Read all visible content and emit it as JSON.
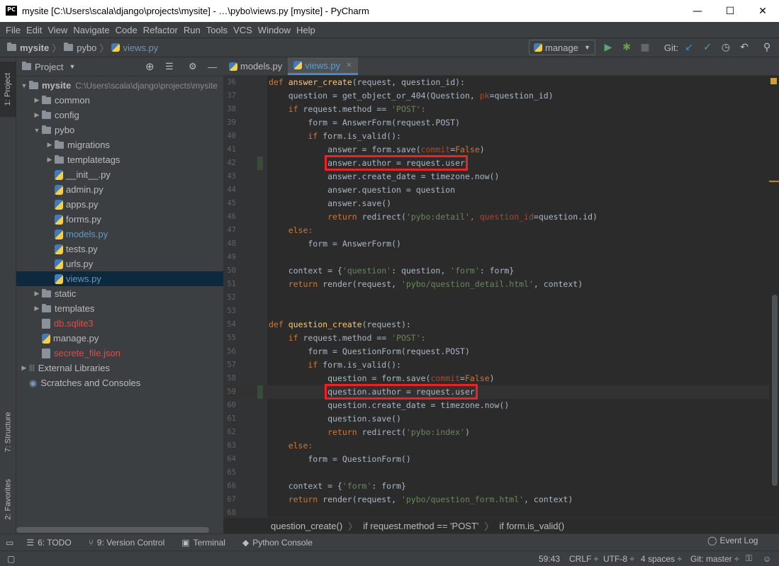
{
  "window": {
    "title": "mysite [C:\\Users\\scala\\django\\projects\\mysite] - …\\pybo\\views.py [mysite] - PyCharm",
    "logo": "PC"
  },
  "menu": [
    "File",
    "Edit",
    "View",
    "Navigate",
    "Code",
    "Refactor",
    "Run",
    "Tools",
    "VCS",
    "Window",
    "Help"
  ],
  "breadcrumbs": [
    "mysite",
    "pybo",
    "views.py"
  ],
  "run_config": "manage",
  "git_label": "Git:",
  "left_tabs": {
    "project": "1: Project",
    "structure": "7: Structure",
    "favorites": "2: Favorites"
  },
  "project_panel": {
    "title": "Project"
  },
  "tree": [
    {
      "label": "mysite",
      "path": "C:\\Users\\scala\\django\\projects\\mysite",
      "type": "folder",
      "depth": 0,
      "arrow": "▼"
    },
    {
      "label": "common",
      "type": "folder",
      "depth": 1,
      "arrow": "▶"
    },
    {
      "label": "config",
      "type": "folder",
      "depth": 1,
      "arrow": "▶"
    },
    {
      "label": "pybo",
      "type": "folder",
      "depth": 1,
      "arrow": "▼"
    },
    {
      "label": "migrations",
      "type": "folder",
      "depth": 2,
      "arrow": "▶"
    },
    {
      "label": "templatetags",
      "type": "folder",
      "depth": 2,
      "arrow": "▶"
    },
    {
      "label": "__init__.py",
      "type": "py",
      "depth": 2
    },
    {
      "label": "admin.py",
      "type": "py",
      "depth": 2
    },
    {
      "label": "apps.py",
      "type": "py",
      "depth": 2
    },
    {
      "label": "forms.py",
      "type": "py",
      "depth": 2
    },
    {
      "label": "models.py",
      "type": "py",
      "depth": 2,
      "color": "#6897bb"
    },
    {
      "label": "tests.py",
      "type": "py",
      "depth": 2
    },
    {
      "label": "urls.py",
      "type": "py",
      "depth": 2
    },
    {
      "label": "views.py",
      "type": "py",
      "depth": 2,
      "color": "#6897bb",
      "selected": true
    },
    {
      "label": "static",
      "type": "folder",
      "depth": 1,
      "arrow": "▶"
    },
    {
      "label": "templates",
      "type": "folder",
      "depth": 1,
      "arrow": "▶"
    },
    {
      "label": "db.sqlite3",
      "type": "file",
      "depth": 1,
      "color": "#d25252"
    },
    {
      "label": "manage.py",
      "type": "py",
      "depth": 1
    },
    {
      "label": "secrete_file.json",
      "type": "file",
      "depth": 1,
      "color": "#d25252"
    },
    {
      "label": "External Libraries",
      "type": "lib",
      "depth": 0,
      "arrow": "▶"
    },
    {
      "label": "Scratches and Consoles",
      "type": "scratch",
      "depth": 0
    }
  ],
  "tabs": [
    {
      "label": "models.py",
      "active": false
    },
    {
      "label": "views.py",
      "active": true
    }
  ],
  "code": [
    {
      "n": "36",
      "s": [
        [
          "kw",
          "def "
        ],
        [
          "fn",
          "answer_create"
        ],
        [
          "",
          "(request, question_id):"
        ]
      ]
    },
    {
      "n": "37",
      "s": [
        [
          "",
          "    question = get_object_or_404(Question, "
        ],
        [
          "param",
          "pk"
        ],
        [
          "",
          "=question_id)"
        ]
      ]
    },
    {
      "n": "38",
      "s": [
        [
          "kw",
          "    if "
        ],
        [
          "",
          "request.method == "
        ],
        [
          "str",
          "'POST'"
        ],
        [
          "kw",
          ":"
        ]
      ]
    },
    {
      "n": "39",
      "s": [
        [
          "",
          "        form = AnswerForm(request.POST)"
        ]
      ]
    },
    {
      "n": "40",
      "s": [
        [
          "kw",
          "        if "
        ],
        [
          "",
          "form.is_valid():"
        ]
      ]
    },
    {
      "n": "41",
      "s": [
        [
          "",
          "            answer = form.save("
        ],
        [
          "param",
          "commit"
        ],
        [
          "",
          "="
        ],
        [
          "kw",
          "False"
        ],
        [
          "",
          ")"
        ]
      ]
    },
    {
      "n": "42",
      "s": [
        [
          "",
          "            "
        ],
        [
          "hl",
          "answer.author = request.user"
        ]
      ]
    },
    {
      "n": "43",
      "s": [
        [
          "",
          "            answer.create_date = timezone.now()"
        ]
      ]
    },
    {
      "n": "44",
      "s": [
        [
          "",
          "            answer.question = question"
        ]
      ]
    },
    {
      "n": "45",
      "s": [
        [
          "",
          "            answer.save()"
        ]
      ]
    },
    {
      "n": "46",
      "s": [
        [
          "kw",
          "            return "
        ],
        [
          "",
          "redirect("
        ],
        [
          "str",
          "'pybo:detail'"
        ],
        [
          "kw",
          ", "
        ],
        [
          "param",
          "question_id"
        ],
        [
          "",
          "=question.id)"
        ]
      ]
    },
    {
      "n": "47",
      "s": [
        [
          "kw",
          "    else:"
        ]
      ]
    },
    {
      "n": "48",
      "s": [
        [
          "",
          "        form = AnswerForm()"
        ]
      ]
    },
    {
      "n": "49",
      "s": [
        [
          "",
          ""
        ]
      ]
    },
    {
      "n": "50",
      "s": [
        [
          "",
          "    context = {"
        ],
        [
          "str",
          "'question'"
        ],
        [
          "",
          ": question, "
        ],
        [
          "str",
          "'form'"
        ],
        [
          "",
          ": form}"
        ]
      ]
    },
    {
      "n": "51",
      "s": [
        [
          "kw",
          "    return "
        ],
        [
          "",
          "render(request, "
        ],
        [
          "str",
          "'pybo/question_detail.html'"
        ],
        [
          "",
          ", context)"
        ]
      ]
    },
    {
      "n": "52",
      "s": [
        [
          "",
          ""
        ]
      ]
    },
    {
      "n": "53",
      "s": [
        [
          "",
          ""
        ]
      ]
    },
    {
      "n": "54",
      "s": [
        [
          "kw",
          "def "
        ],
        [
          "fn",
          "question_create"
        ],
        [
          "",
          "(request):"
        ]
      ]
    },
    {
      "n": "55",
      "s": [
        [
          "kw",
          "    if "
        ],
        [
          "",
          "request.method == "
        ],
        [
          "str",
          "'POST'"
        ],
        [
          "kw",
          ":"
        ]
      ]
    },
    {
      "n": "56",
      "s": [
        [
          "",
          "        form = QuestionForm(request.POST)"
        ]
      ]
    },
    {
      "n": "57",
      "s": [
        [
          "kw",
          "        if "
        ],
        [
          "",
          "form.is_valid():"
        ]
      ]
    },
    {
      "n": "58",
      "s": [
        [
          "",
          "            question = form.save("
        ],
        [
          "param",
          "commit"
        ],
        [
          "",
          "="
        ],
        [
          "kw",
          "False"
        ],
        [
          "",
          ")"
        ]
      ]
    },
    {
      "n": "59",
      "s": [
        [
          "",
          "            "
        ],
        [
          "hl",
          "question.author = request.user"
        ]
      ]
    },
    {
      "n": "60",
      "s": [
        [
          "",
          "            question.create_date = timezone.now()"
        ]
      ]
    },
    {
      "n": "61",
      "s": [
        [
          "",
          "            question.save()"
        ]
      ]
    },
    {
      "n": "62",
      "s": [
        [
          "kw",
          "            return "
        ],
        [
          "",
          "redirect("
        ],
        [
          "str",
          "'pybo:index'"
        ],
        [
          "",
          ")"
        ]
      ]
    },
    {
      "n": "63",
      "s": [
        [
          "kw",
          "    else:"
        ]
      ]
    },
    {
      "n": "64",
      "s": [
        [
          "",
          "        form = QuestionForm()"
        ]
      ]
    },
    {
      "n": "65",
      "s": [
        [
          "",
          ""
        ]
      ]
    },
    {
      "n": "66",
      "s": [
        [
          "",
          "    context = {"
        ],
        [
          "str",
          "'form'"
        ],
        [
          "",
          ": form}"
        ]
      ]
    },
    {
      "n": "67",
      "s": [
        [
          "kw",
          "    return "
        ],
        [
          "",
          "render(request, "
        ],
        [
          "str",
          "'pybo/question_form.html'"
        ],
        [
          "",
          ", context)"
        ]
      ]
    },
    {
      "n": "68",
      "s": [
        [
          "",
          ""
        ]
      ]
    }
  ],
  "code_breadcrumb": [
    "question_create()",
    "if request.method == 'POST'",
    "if form.is_valid()"
  ],
  "tool_windows": [
    "6: TODO",
    "9: Version Control",
    "Terminal",
    "Python Console"
  ],
  "event_log": "Event Log",
  "status": {
    "position": "59:43",
    "line_sep": "CRLF ÷",
    "encoding": "UTF-8 ÷",
    "indent": "4 spaces ÷",
    "git": "Git: master ÷"
  }
}
